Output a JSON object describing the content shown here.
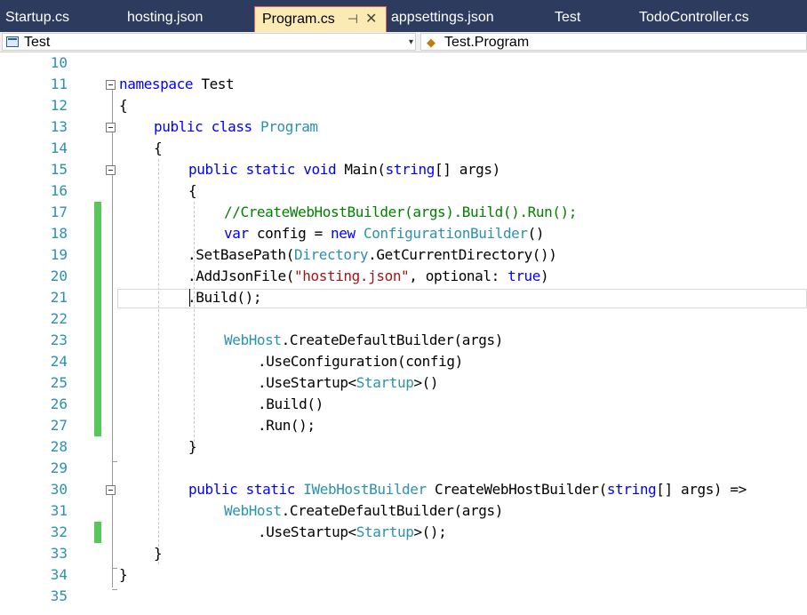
{
  "tabs": [
    {
      "label": "Startup.cs"
    },
    {
      "label": "hosting.json"
    },
    {
      "label": "Program.cs",
      "pin": "⊣",
      "close": "✕"
    },
    {
      "label": "appsettings.json"
    },
    {
      "label": "Test"
    },
    {
      "label": "TodoController.cs"
    }
  ],
  "navbar": {
    "project": "Test",
    "type": "Test.Program",
    "dropdown_arrow": "▾"
  },
  "line_numbers": [
    "10",
    "11",
    "12",
    "13",
    "14",
    "15",
    "16",
    "17",
    "18",
    "19",
    "20",
    "21",
    "22",
    "23",
    "24",
    "25",
    "26",
    "27",
    "28",
    "29",
    "30",
    "31",
    "32",
    "33",
    "34",
    "35"
  ],
  "code": {
    "l11_kw": "namespace",
    "l11_name": " Test",
    "l12": "{",
    "l13_kw": "public class",
    "l13_type": "Program",
    "l14": "{",
    "l15_kw": "public static void",
    "l15_mid": " Main(",
    "l15_kw2": "string",
    "l15_end": "[] args)",
    "l16": "{",
    "l17_comment": "//CreateWebHostBuilder(args).Build().Run();",
    "l18_kw": "var",
    "l18_mid": " config = ",
    "l18_kw2": "new",
    "l18_type": "ConfigurationBuilder",
    "l18_end": "()",
    "l19_a": ".SetBasePath(",
    "l19_type": "Directory",
    "l19_b": ".GetCurrentDirectory())",
    "l20_a": ".AddJsonFile(",
    "l20_str": "\"hosting.json\"",
    "l20_b": ", optional: ",
    "l20_kw": "true",
    "l20_c": ")",
    "l21": ".Build();",
    "l23_type": "WebHost",
    "l23_rest": ".CreateDefaultBuilder(args)",
    "l24": ".UseConfiguration(config)",
    "l25_a": ".UseStartup<",
    "l25_type": "Startup",
    "l25_b": ">()",
    "l26": ".Build()",
    "l27": ".Run();",
    "l28": "}",
    "l30_kw": "public static",
    "l30_type": "IWebHostBuilder",
    "l30_mid": " CreateWebHostBuilder(",
    "l30_kw2": "string",
    "l30_end": "[] args) =>",
    "l31_type": "WebHost",
    "l31_rest": ".CreateDefaultBuilder(args)",
    "l32_a": ".UseStartup<",
    "l32_type": "Startup",
    "l32_b": ">();",
    "l33": "}",
    "l34": "}"
  },
  "colors": {
    "tabbar_bg": "#2d3b5f",
    "active_tab_bg": "#fbeab4",
    "keyword": "#0000ff",
    "type": "#2b91af",
    "string": "#a31515",
    "comment": "#008000",
    "change_bar": "#57c75a",
    "line_number": "#2b91af"
  }
}
